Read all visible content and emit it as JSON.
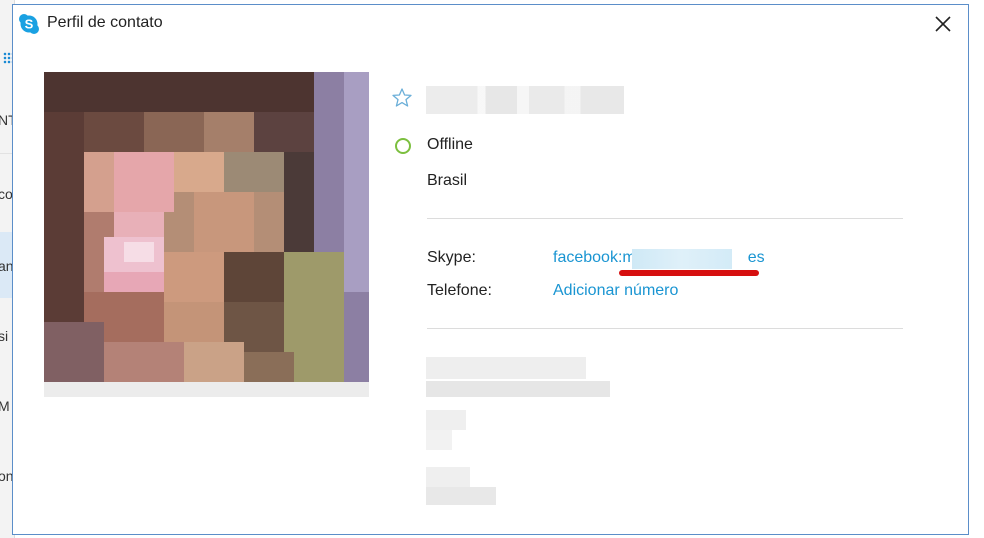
{
  "window": {
    "title": "Perfil de contato"
  },
  "background_app": {
    "fragments": [
      "NT",
      "co",
      "an",
      "si",
      "M",
      "on"
    ]
  },
  "profile": {
    "status": "Offline",
    "location": "Brasil",
    "skype_label": "Skype:",
    "skype_value_prefix": "facebook:m",
    "skype_value_suffix": "es",
    "phone_label": "Telefone:",
    "phone_action": "Adicionar número"
  },
  "colors": {
    "accent": "#1a95d2",
    "status_offline": "#7cbf3f",
    "annotation": "#d60f0f",
    "window_border": "#5b8ec9"
  },
  "icons": {
    "app": "skype-logo-icon",
    "close": "close-icon",
    "favorite": "star-icon",
    "status": "status-circle-icon"
  }
}
